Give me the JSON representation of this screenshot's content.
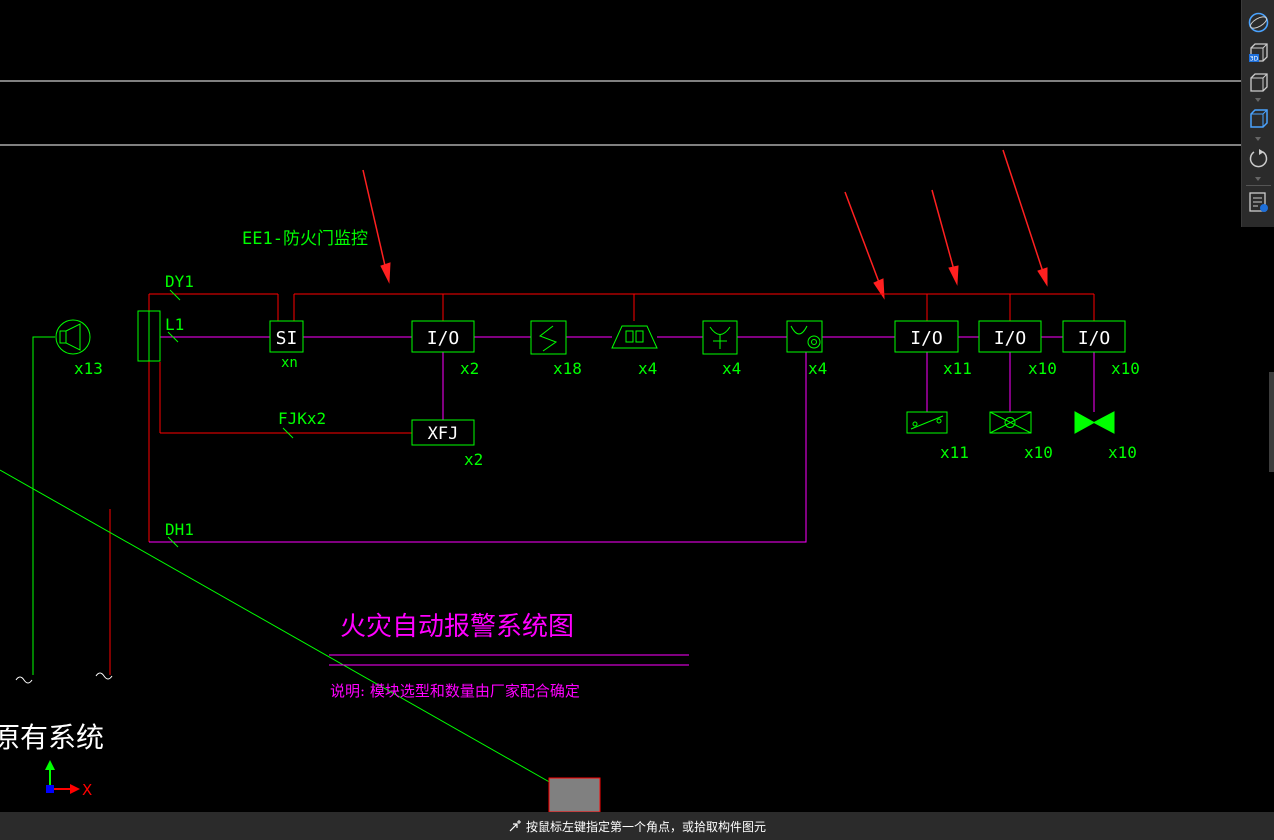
{
  "drawing": {
    "subtitle": "EE1-防火门监控",
    "bus_labels": {
      "dy": "DY1",
      "l": "L1",
      "dh": "DH1",
      "fjk": "FJKx2"
    },
    "modules": {
      "si": "SI",
      "io": "I/O",
      "xfj": "XFJ"
    },
    "counts": {
      "speaker": "x13",
      "si": "xn",
      "io_1": "x2",
      "xfj": "x2",
      "smoke": "x18",
      "alarm_bell": "x4",
      "hydrant": "x4",
      "manual": "x4",
      "io_2": "x11",
      "io_3": "x10",
      "io_4": "x10",
      "valve_1": "x11",
      "valve_2": "x10",
      "valve_3": "x10"
    },
    "title": "火灾自动报警系统图",
    "note": "说明: 模块选型和数量由厂家配合确定",
    "existing_system": "原有系统",
    "axis": {
      "x": "X"
    }
  },
  "status_bar": {
    "prompt": "按鼠标左键指定第一个角点，或拾取构件图元"
  },
  "toolbar": {
    "icons": [
      "orbit-icon",
      "view-3d-icon",
      "view-cube-icon",
      "view-cube-blue-icon",
      "rotate-icon",
      "properties-icon"
    ]
  },
  "colors": {
    "background": "#000000",
    "green": "#00ff00",
    "red": "#ff0000",
    "magenta": "#ff00ff",
    "white": "#ffffff",
    "gray": "#808080"
  }
}
